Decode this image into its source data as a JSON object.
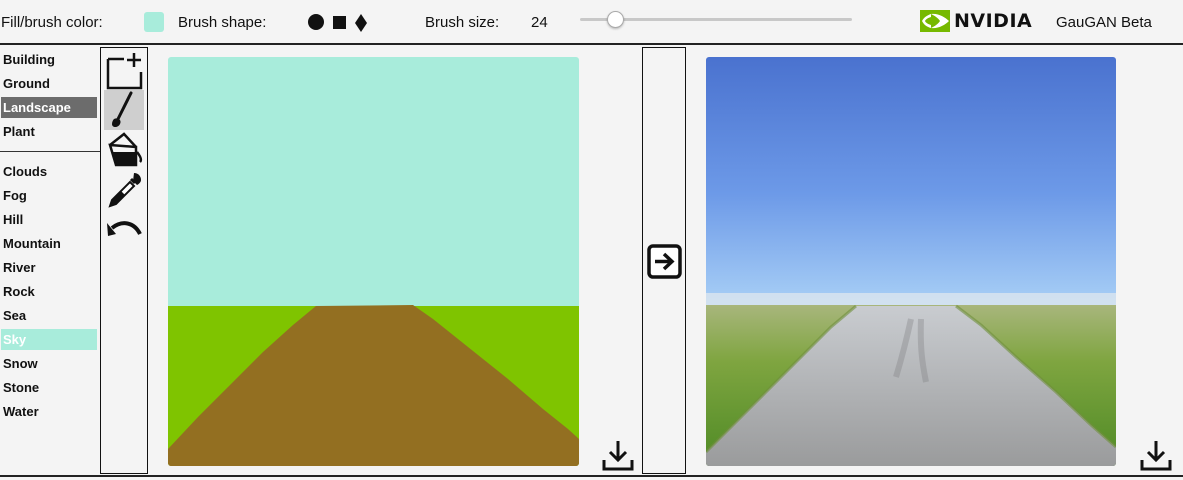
{
  "toolbar": {
    "fill_color_label": "Fill/brush color:",
    "fill_color": "#a8ecdb",
    "brush_shape_label": "Brush shape:",
    "brush_shapes": [
      "circle",
      "square",
      "diamond"
    ],
    "brush_size_label": "Brush size:",
    "brush_size_value": "24",
    "brush_size_fraction": 0.13,
    "brand_text": "NVIDIA",
    "brand_color": "#76b900",
    "app_title": "GauGAN Beta"
  },
  "labels": {
    "group1": [
      "Building",
      "Ground",
      "Landscape",
      "Plant"
    ],
    "group2": [
      "Clouds",
      "Fog",
      "Hill",
      "Mountain",
      "River",
      "Rock",
      "Sea",
      "Sky",
      "Snow",
      "Stone",
      "Water"
    ],
    "selected_category": "Landscape",
    "selected_category_bg": "#6c6c6c",
    "selected_label": "Sky",
    "selected_label_bg": "#a8ecdb"
  },
  "tools": [
    "new-canvas-icon",
    "brush-icon",
    "paint-bucket-icon",
    "eyedropper-icon",
    "undo-icon"
  ],
  "active_tool": "brush-icon",
  "segmentation_colors": {
    "sky": "#a8ecdb",
    "grass": "#7fc400",
    "road": "#936f21"
  },
  "icons": {
    "render": "arrow-right-box-icon",
    "download": "download-icon"
  }
}
